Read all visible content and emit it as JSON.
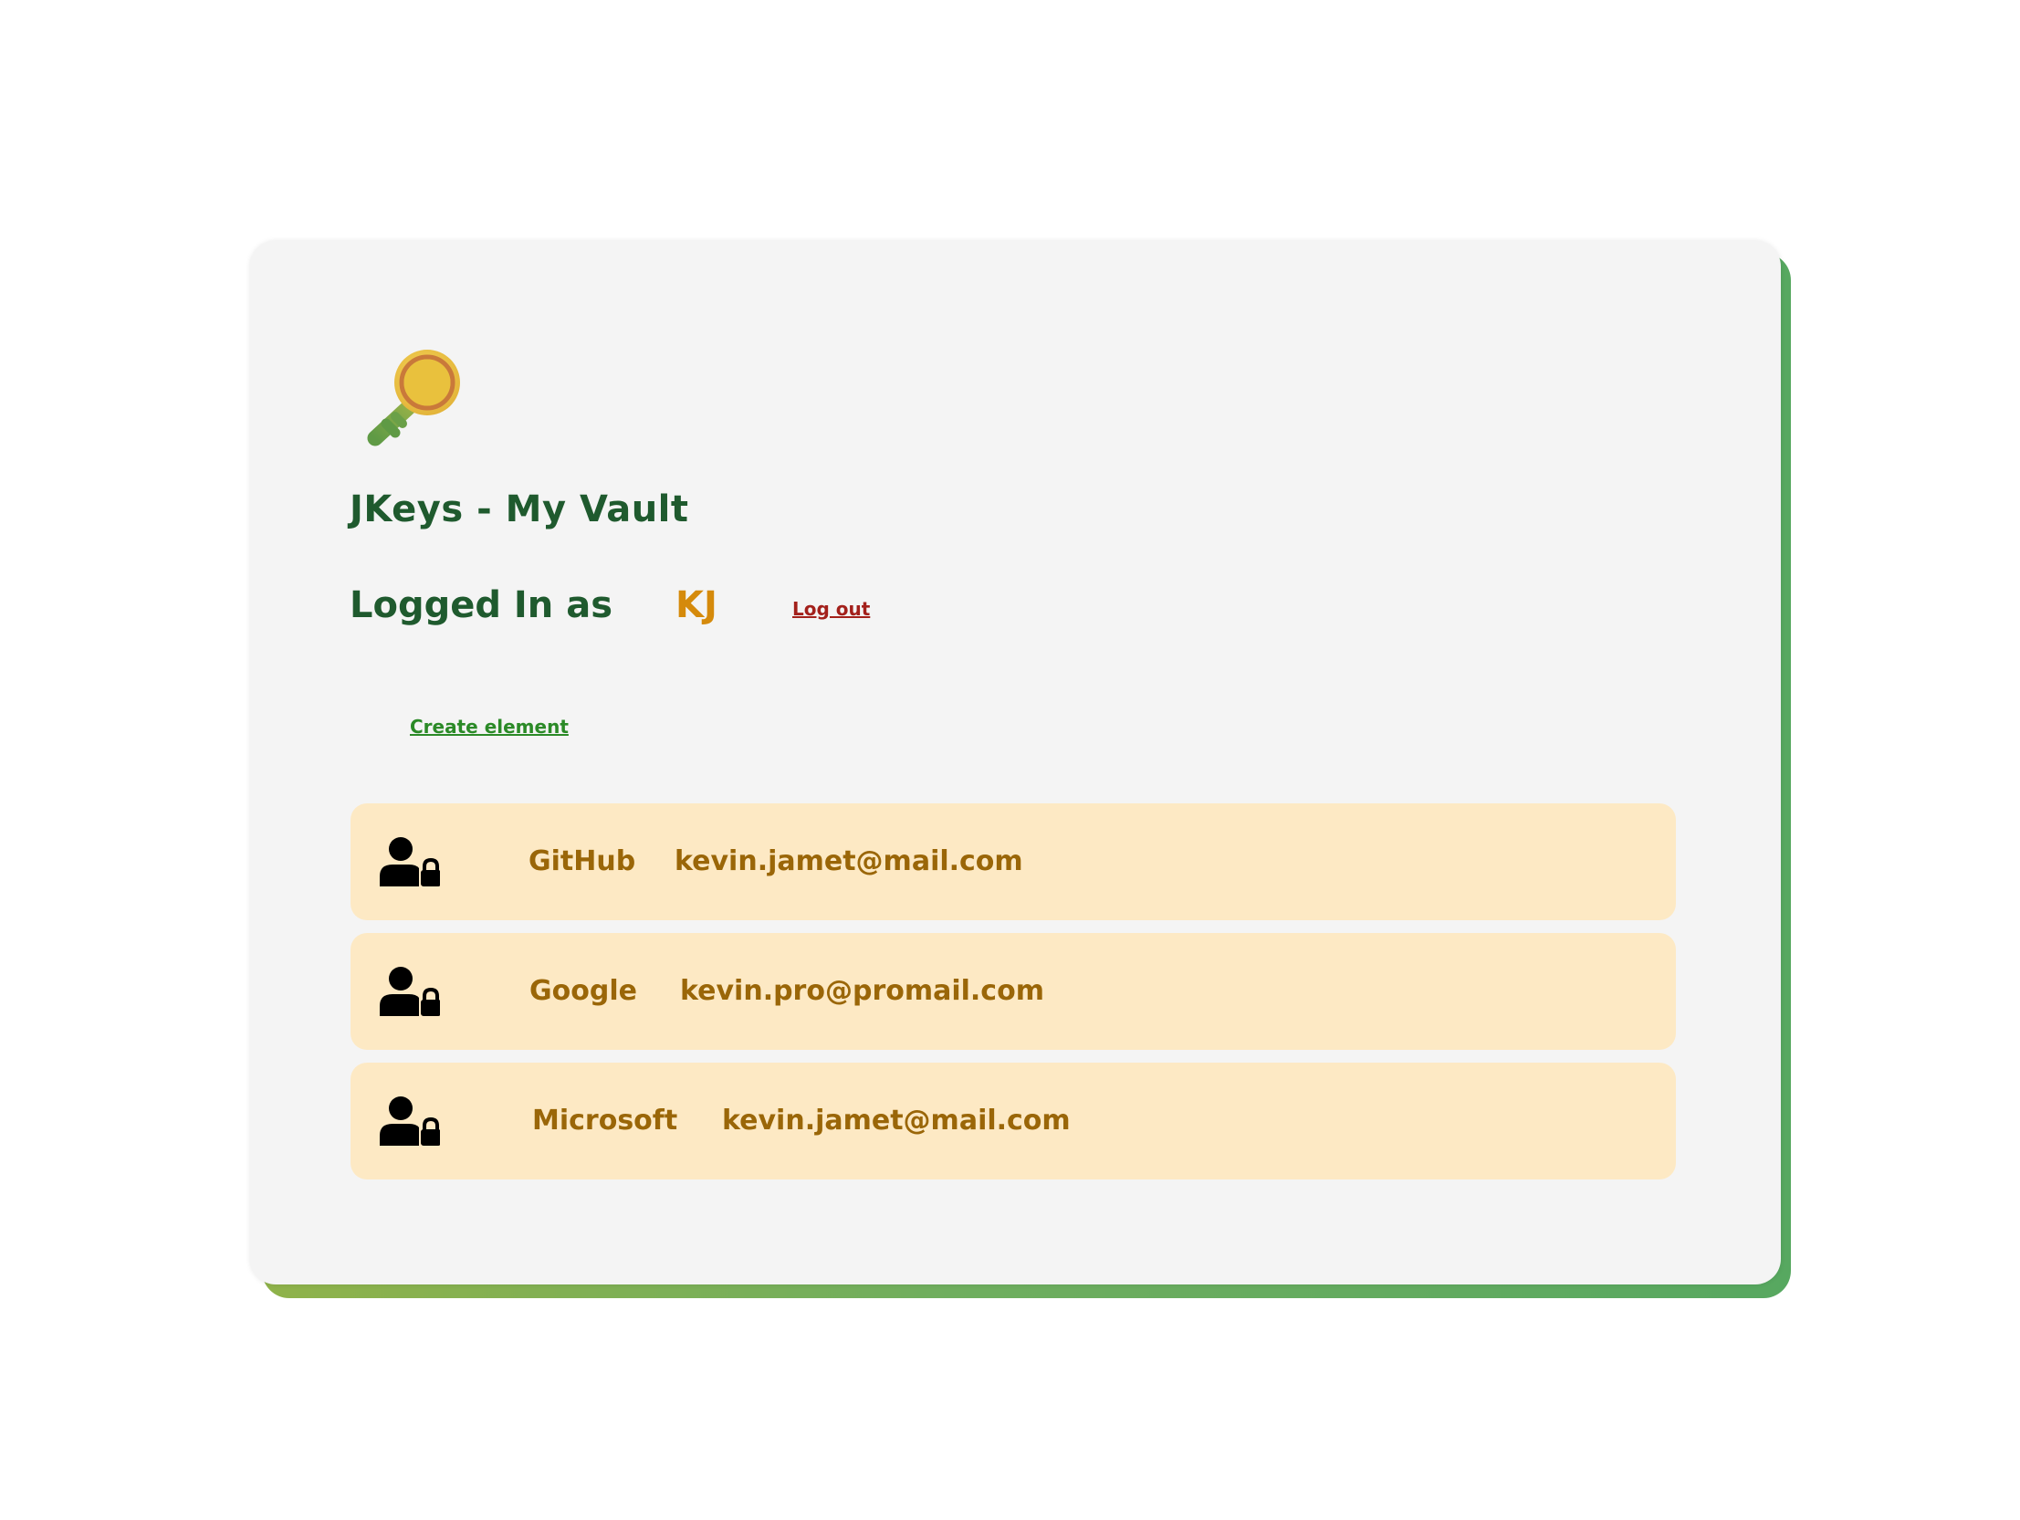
{
  "header": {
    "title": "JKeys - My Vault",
    "logo_icon": "key-icon"
  },
  "session": {
    "logged_in_label": "Logged In as",
    "user_initials": "KJ",
    "logout_label": "Log out"
  },
  "actions": {
    "create_label": "Create element"
  },
  "vault": {
    "entries": [
      {
        "service": "GitHub",
        "account": "kevin.jamet@mail.com",
        "icon": "user-lock-icon"
      },
      {
        "service": "Google",
        "account": "kevin.pro@promail.com",
        "icon": "user-lock-icon"
      },
      {
        "service": "Microsoft",
        "account": "kevin.jamet@mail.com",
        "icon": "user-lock-icon"
      }
    ]
  },
  "colors": {
    "heading": "#1f5a2e",
    "initials": "#d58a0b",
    "logout": "#a3201b",
    "create": "#2b8a27",
    "entry_background": "#fde9c4",
    "entry_text": "#9a6608",
    "card_background": "#f4f4f4"
  }
}
